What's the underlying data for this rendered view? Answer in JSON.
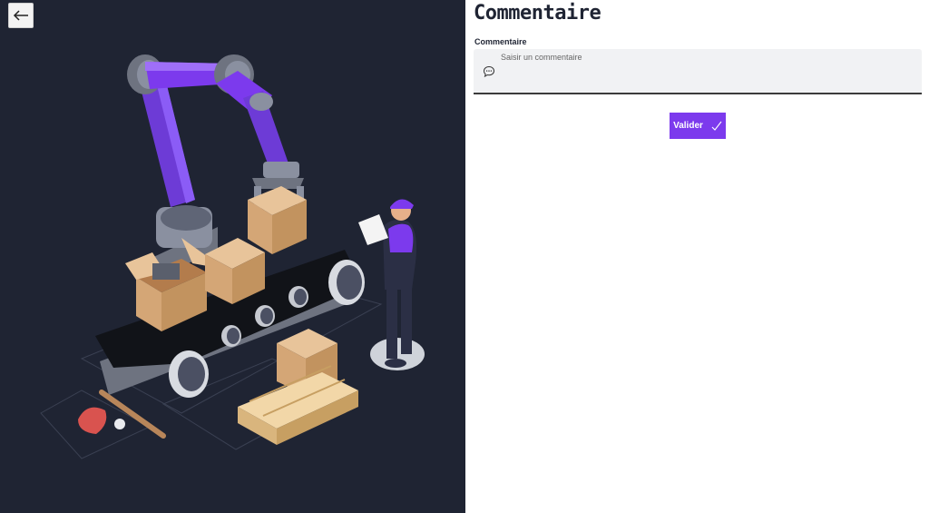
{
  "page": {
    "title": "Commentaire"
  },
  "comment": {
    "label": "Commentaire",
    "placeholder": "Saisir un commentaire",
    "value": ""
  },
  "actions": {
    "submit_label": "Valider",
    "submit_icon": "check-icon",
    "back_icon": "arrow-left-icon"
  },
  "colors": {
    "accent": "#7c3aed",
    "dark_background": "#1f2433",
    "input_background": "#f1f2f4"
  }
}
